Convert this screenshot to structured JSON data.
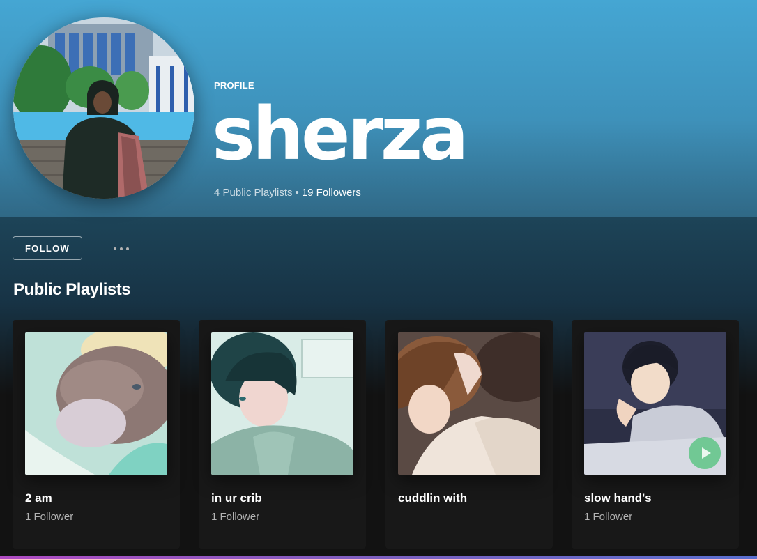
{
  "profile": {
    "type_label": "PROFILE",
    "name": "sherza",
    "playlists_count": "4 Public Playlists",
    "separator": "•",
    "followers_count": "19 Followers",
    "avatar_alt": "Profile photo by a swimming pool"
  },
  "actions": {
    "follow_label": "FOLLOW",
    "more_icon": "ellipsis-icon"
  },
  "section": {
    "title": "Public Playlists"
  },
  "playlists": [
    {
      "title": "2 am",
      "subtitle": "1 Follower"
    },
    {
      "title": "in ur crib",
      "subtitle": "1 Follower"
    },
    {
      "title": "cuddlin with",
      "subtitle": ""
    },
    {
      "title": "slow hand's",
      "subtitle": "1 Follower"
    }
  ],
  "colors": {
    "header_blue": "#45a6d3",
    "background": "#121212",
    "card": "#181818",
    "accent_green": "#1db954"
  }
}
